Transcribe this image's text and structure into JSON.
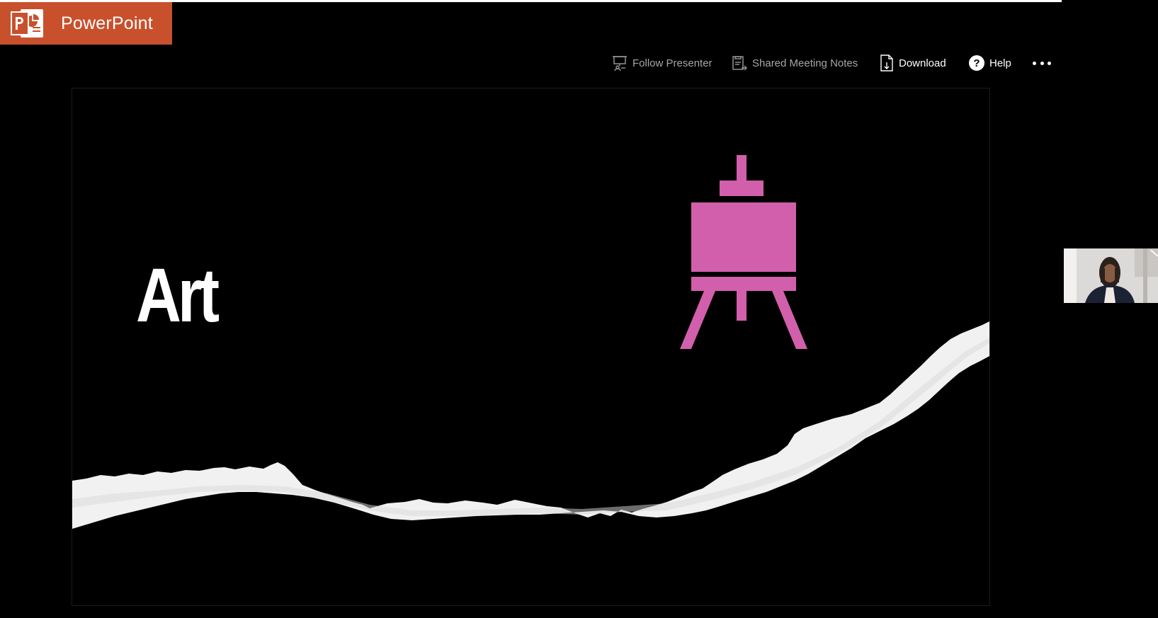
{
  "app": {
    "name": "PowerPoint",
    "brand_color": "#c8502d"
  },
  "toolbar": {
    "follow_presenter": "Follow Presenter",
    "shared_notes": "Shared Meeting Notes",
    "download": "Download",
    "help": "Help",
    "more_icon": "more-dots-icon"
  },
  "slide": {
    "title": "Art",
    "icon": "easel-icon",
    "icon_color": "#d25fab",
    "background": "#000000"
  },
  "participant_video": {
    "icon": "participant-video"
  }
}
